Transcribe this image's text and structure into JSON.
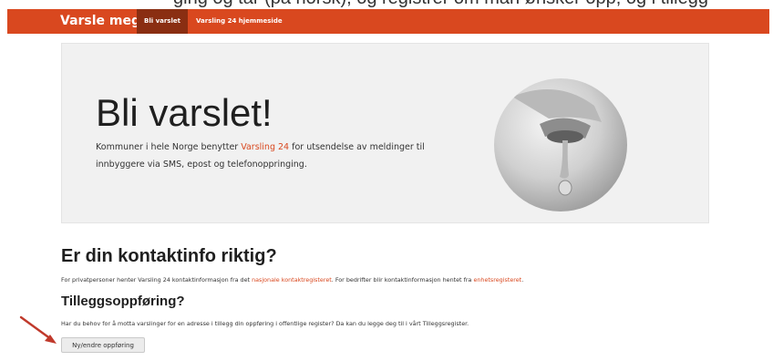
{
  "clipped_caption": "ging og tar (på norsk), og registrer om man ønsker opp, og i tillegg",
  "navbar": {
    "brand": "Varsle meg",
    "items": [
      {
        "label": "Bli varslet",
        "active": true
      },
      {
        "label": "Varsling 24 hjemmeside",
        "active": false
      }
    ],
    "color": "#d9481f"
  },
  "jumbotron": {
    "title": "Bli varslet!",
    "text_before": "Kommuner i hele Norge benytter ",
    "text_link": "Varsling 24",
    "text_after": " for utsendelse av meldinger til innbyggere via SMS, epost og telefonoppringing.",
    "image_icon": "faucet-drop-image"
  },
  "contact": {
    "title": "Er din kontaktinfo riktig?",
    "text_before": "For privatpersoner henter Varsling 24 kontaktinformasjon fra det ",
    "link1": "nasjonale kontaktregisteret",
    "text_mid": ". For bedrifter blir kontaktinformasjon hentet fra ",
    "link2": "enhetsregisteret",
    "text_after": "."
  },
  "extra": {
    "title": "Tilleggsoppføring?",
    "text": "Har du behov for å motta varslinger for en adresse i tillegg din oppføring i offentlige register? Da kan du legge deg til i vårt Tilleggsregister.",
    "button_label": "Ny/endre oppføring"
  },
  "annotation_icon": "red-arrow-icon"
}
